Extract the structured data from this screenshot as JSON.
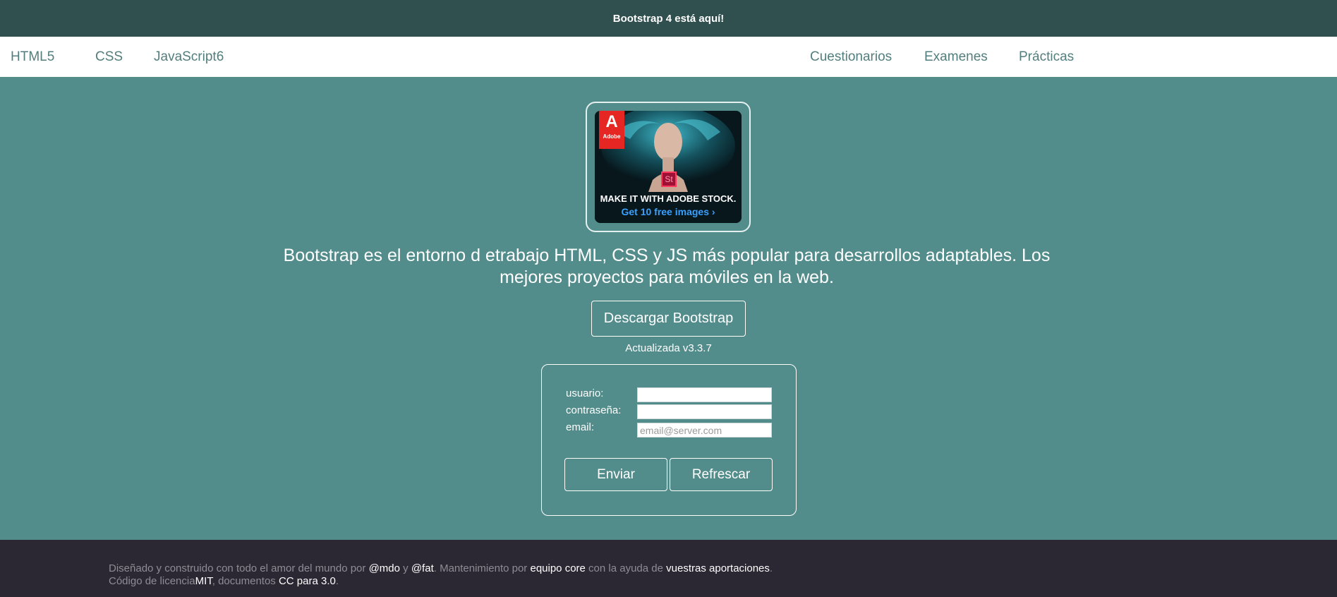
{
  "announcement": "Bootstrap 4 está aquí!",
  "nav": {
    "left": [
      "HTML5",
      "CSS",
      "JavaScript6"
    ],
    "right": [
      "Cuestionarios",
      "Examenes",
      "Prácticas"
    ]
  },
  "ad": {
    "brand": "Adobe",
    "logo_letter": "A",
    "product_badge": "St",
    "headline": "MAKE IT WITH ADOBE STOCK.",
    "cta": "Get 10 free images ›",
    "colors": {
      "brand": "#e62622",
      "cta": "#3aa0ff"
    }
  },
  "hero": {
    "lead": "Bootstrap es el entorno d etrabajo HTML, CSS y JS más popular para desarrollos adaptables. Los mejores proyectos para móviles en la web.",
    "download_label": "Descargar Bootstrap",
    "version": "Actualizada v3.3.7"
  },
  "form": {
    "user_label": "usuario:",
    "user_value": "",
    "password_label": "contraseña:",
    "password_value": "",
    "email_label": "email:",
    "email_value": "",
    "email_placeholder": "email@server.com",
    "submit_label": "Enviar",
    "reset_label": "Refrescar"
  },
  "footer": {
    "line1": {
      "t1": "Diseñado y construido con todo el amor del mundo por ",
      "mdo": "@mdo",
      "t2": " y ",
      "fat": "@fat",
      "t3": ". Mantenimiento por ",
      "team": "equipo core",
      "t4": " con la ayuda de ",
      "contrib": "vuestras aportaciones",
      "t5": "."
    },
    "line2": {
      "t1": "Código de licencia",
      "mit": "MIT",
      "t2": ", documentos ",
      "cc": "CC para 3.0",
      "t3": "."
    }
  },
  "colors": {
    "topbar": "#2f504f",
    "navbar": "#ffffff",
    "nav_link": "#527e7d",
    "background": "#528c8b",
    "footer": "#2b2733"
  }
}
